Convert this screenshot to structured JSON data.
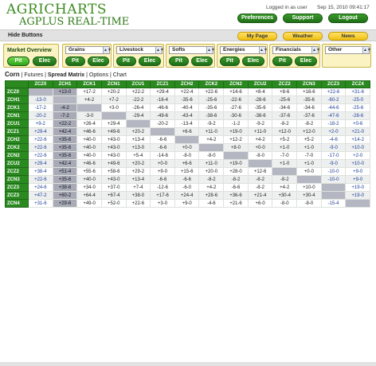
{
  "logo": {
    "agri": "AGRICHARTS",
    "product": "AGPLUS REAL-TIME"
  },
  "status": {
    "user": "Logged in as user",
    "datetime": "Sep 15, 2010 09:41:17"
  },
  "header_buttons": {
    "preferences": "Preferences",
    "support": "Support",
    "logout": "Logout"
  },
  "hide_bar": {
    "label": "Hide Buttons",
    "my_page": "My Page",
    "weather": "Weather",
    "news": "News"
  },
  "market": {
    "overview_title": "Market Overview",
    "pit": "Pit",
    "elec": "Elec",
    "dropdowns": [
      "Grains",
      "Livestock",
      "Softs",
      "Energies",
      "Financials",
      "Other"
    ]
  },
  "breadcrumb": {
    "symbol": "Corn",
    "sep": "|",
    "futures": "Futures",
    "spread_matrix": "Spread Matrix",
    "options": "Options",
    "chart": "Chart"
  },
  "colors": {
    "green": "#2a8a1f",
    "yellow": "#f0c010",
    "highlight": "#a8abb6",
    "link_blue": "#1c3e99"
  },
  "matrix": {
    "columns": [
      "ZCZ0",
      "ZCH1",
      "ZCK1",
      "ZCN1",
      "ZCU1",
      "ZCZ1",
      "ZCH2",
      "ZCK2",
      "ZCN2",
      "ZCU2",
      "ZCZ2",
      "ZCN3",
      "ZCZ3",
      "ZCZ4"
    ],
    "rows": [
      {
        "label": "ZCZ0",
        "cells": [
          "",
          "+13-0",
          "+17-2",
          "+20-2",
          "+22-2",
          "+29-4",
          "+22-4",
          "+22-6",
          "+14-6",
          "+8-4",
          "+8-6",
          "+16-6",
          "+22-6",
          "+31-6"
        ]
      },
      {
        "label": "ZCH1",
        "cells": [
          "-13-0",
          "",
          "+4-2",
          "+7-2",
          "-22-2",
          "-16-4",
          "-35-6",
          "-25-6",
          "-22-6",
          "-28-6",
          "-25-6",
          "-35-6",
          "-60-2",
          "-25-0"
        ]
      },
      {
        "label": "ZCK1",
        "cells": [
          "-17-2",
          "-4-2",
          "",
          "+3-0",
          "-26-4",
          "-46-6",
          "-40-4",
          "-35-6",
          "-27-6",
          "-35-6",
          "-34-6",
          "-34-6",
          "-44-6",
          "-25-6"
        ]
      },
      {
        "label": "ZCN1",
        "cells": [
          "-20-2",
          "-7-2",
          "-3-0",
          "",
          "-29-4",
          "-49-6",
          "-43-4",
          "-38-6",
          "-30-6",
          "-38-6",
          "-37-6",
          "-37-6",
          "-47-6",
          "-28-6"
        ]
      },
      {
        "label": "ZCU1",
        "cells": [
          "+9-2",
          "+22-2",
          "+26-4",
          "+29-4",
          "",
          "-20-2",
          "-13-4",
          "-9-2",
          "-1-2",
          "-9-2",
          "-8-2",
          "-8-2",
          "-18-2",
          "+0-6"
        ]
      },
      {
        "label": "ZCZ1",
        "cells": [
          "+29-4",
          "+42-4",
          "+46-6",
          "+49-6",
          "+20-2",
          "",
          "+6-6",
          "+11-0",
          "+19-0",
          "+11-0",
          "+12-0",
          "+12-0",
          "+2-0",
          "+21-0"
        ]
      },
      {
        "label": "ZCH2",
        "cells": [
          "+22-6",
          "+35-6",
          "+40-0",
          "+43-0",
          "+13-4",
          "-6-6",
          "",
          "+4-2",
          "+12-2",
          "+4-2",
          "+5-2",
          "+5-2",
          "-4-6",
          "+14-2"
        ]
      },
      {
        "label": "ZCK2",
        "cells": [
          "+22-6",
          "+35-6",
          "+40-0",
          "+43-0",
          "+13-0",
          "-6-6",
          "+0-0",
          "",
          "+8-0",
          "+0-0",
          "+1-0",
          "+1-0",
          "-9-0",
          "+10-0"
        ]
      },
      {
        "label": "ZCN2",
        "cells": [
          "+22-6",
          "+35-6",
          "+40-0",
          "+43-0",
          "+5-4",
          "-14-6",
          "-8-0",
          "-8-0",
          "",
          "-8-0",
          "-7-0",
          "-7-0",
          "-17-0",
          "+2-0"
        ]
      },
      {
        "label": "ZCU2",
        "cells": [
          "+29-4",
          "+42-4",
          "+46-6",
          "+49-6",
          "+20-2",
          "+0-0",
          "+6-6",
          "+11-0",
          "+19-0",
          "",
          "+1-0",
          "+1-0",
          "-9-0",
          "+10-0"
        ]
      },
      {
        "label": "ZCZ2",
        "cells": [
          "+38-4",
          "+51-4",
          "+55-6",
          "+58-6",
          "+29-2",
          "+9-0",
          "+15-6",
          "+20-0",
          "+28-0",
          "+12-6",
          "",
          "+0-0",
          "-10-0",
          "+9-0"
        ]
      },
      {
        "label": "ZCN3",
        "cells": [
          "+22-6",
          "+35-6",
          "+40-0",
          "+43-0",
          "+13-4",
          "-6-6",
          "-6-6",
          "-8-2",
          "-8-2",
          "-8-2",
          "-8-2",
          "",
          "-10-0",
          "+9-0"
        ]
      },
      {
        "label": "ZCZ3",
        "cells": [
          "+24-6",
          "+38-6",
          "+34-0",
          "+37-0",
          "+7-4",
          "-12-6",
          "-6-0",
          "+4-2",
          "-6-6",
          "-8-2",
          "+4-2",
          "+10-0",
          "",
          "+19-0"
        ]
      },
      {
        "label": "ZCZ3",
        "cells": [
          "+47-2",
          "+60-2",
          "+64-4",
          "+67-4",
          "+38-0",
          "+17-6",
          "+24-4",
          "+28-6",
          "+36-6",
          "+21-4",
          "+30-4",
          "+30-4",
          "",
          "+19-0"
        ]
      },
      {
        "label": "ZCN4",
        "cells": [
          "+31-6",
          "+29-6",
          "+49-0",
          "+52-0",
          "+22-6",
          "+3-0",
          "+9-0",
          "-4-6",
          "+21-6",
          "+6-0",
          "-8-0",
          "-8-0",
          "-15-4",
          ""
        ]
      }
    ]
  }
}
